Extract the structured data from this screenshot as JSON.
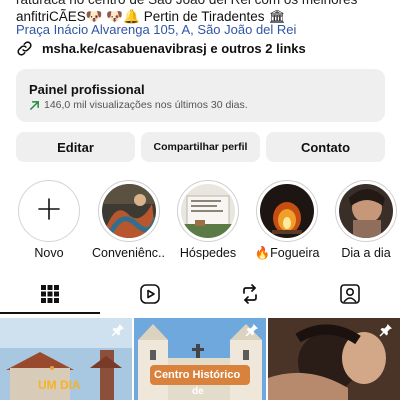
{
  "profile": {
    "bio_top": "raturaca no centro de São João del Rei com os melhores",
    "bio_second": "anfitriCÃES🐶 🐶🔔 Pertin de Tiradentes 🏛",
    "address": "Praça Inácio Alvarenga 105, A, São João del Rei",
    "link": "msha.ke/casabuenavibrasj e outros 2 links"
  },
  "dashboard": {
    "title": "Painel profissional",
    "stats": "146,0 mil visualizações nos últimos 30 dias."
  },
  "buttons": {
    "edit": "Editar",
    "share": "Compartilhar perfil",
    "contact": "Contato"
  },
  "highlights": [
    {
      "label": "Novo",
      "icon": "plus-icon"
    },
    {
      "label": "Conveniênc..."
    },
    {
      "label": "Hóspedes"
    },
    {
      "label": "🔥Fogueira"
    },
    {
      "label": "Dia a dia"
    }
  ],
  "tabs": [
    {
      "name": "grid",
      "icon": "grid-icon",
      "active": true
    },
    {
      "name": "reels",
      "icon": "reels-icon"
    },
    {
      "name": "reposts",
      "icon": "repost-icon"
    },
    {
      "name": "tagged",
      "icon": "tagged-icon"
    }
  ],
  "posts": [
    {
      "caption": "UM DIA",
      "pinned": true
    },
    {
      "caption": "Centro Histórico",
      "caption2": "de",
      "pinned": true
    },
    {
      "caption": "",
      "pinned": true
    }
  ],
  "colors": {
    "link_blue": "#2f55a4",
    "button_bg": "#efeff0",
    "trend_green": "#1f8a3c"
  }
}
